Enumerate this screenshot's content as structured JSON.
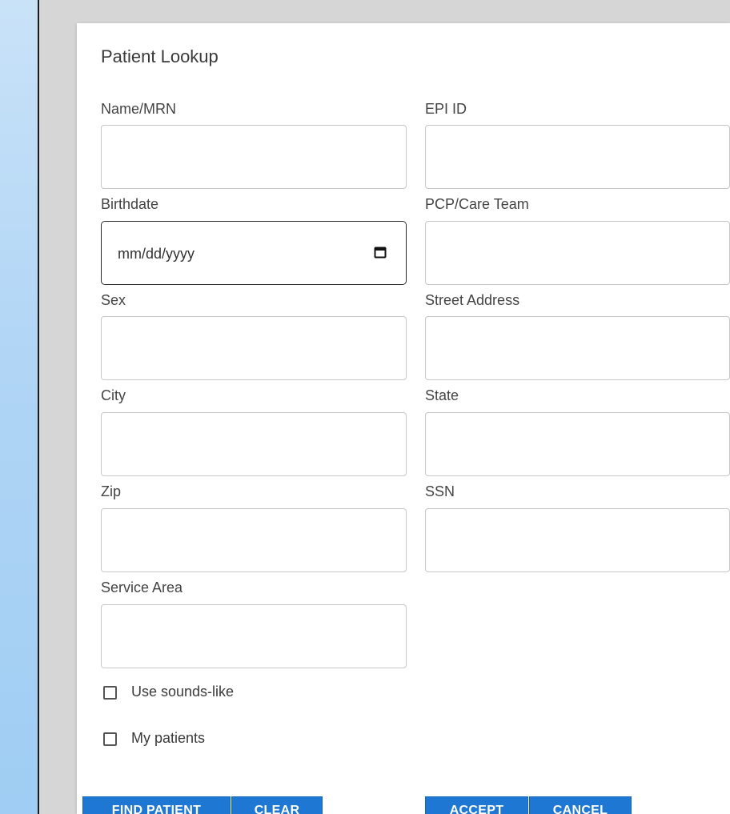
{
  "dialog": {
    "title": "Patient Lookup"
  },
  "fields": {
    "name_mrn": {
      "label": "Name/MRN",
      "value": ""
    },
    "epi_id": {
      "label": "EPI ID",
      "value": ""
    },
    "birthdate": {
      "label": "Birthdate",
      "placeholder": "mm/dd/yyyy"
    },
    "pcp_care_team": {
      "label": "PCP/Care Team",
      "value": ""
    },
    "sex": {
      "label": "Sex",
      "value": ""
    },
    "street_address": {
      "label": "Street Address",
      "value": ""
    },
    "city": {
      "label": "City",
      "value": ""
    },
    "state": {
      "label": "State",
      "value": ""
    },
    "zip": {
      "label": "Zip",
      "value": ""
    },
    "ssn": {
      "label": "SSN",
      "value": ""
    },
    "service_area": {
      "label": "Service Area",
      "value": ""
    }
  },
  "options": {
    "use_sounds_like": {
      "label": "Use sounds-like",
      "checked": false
    },
    "my_patients": {
      "label": "My patients",
      "checked": false
    }
  },
  "buttons": {
    "find_patient": "FIND PATIENT",
    "clear": "CLEAR",
    "accept": "ACCEPT",
    "cancel": "CANCEL"
  },
  "icons": {
    "birthdate_picker": "calendar-icon"
  },
  "colors": {
    "sidebar": "#b0d5f5",
    "workspace": "#d6d6d6",
    "button": "#1e77d3"
  }
}
